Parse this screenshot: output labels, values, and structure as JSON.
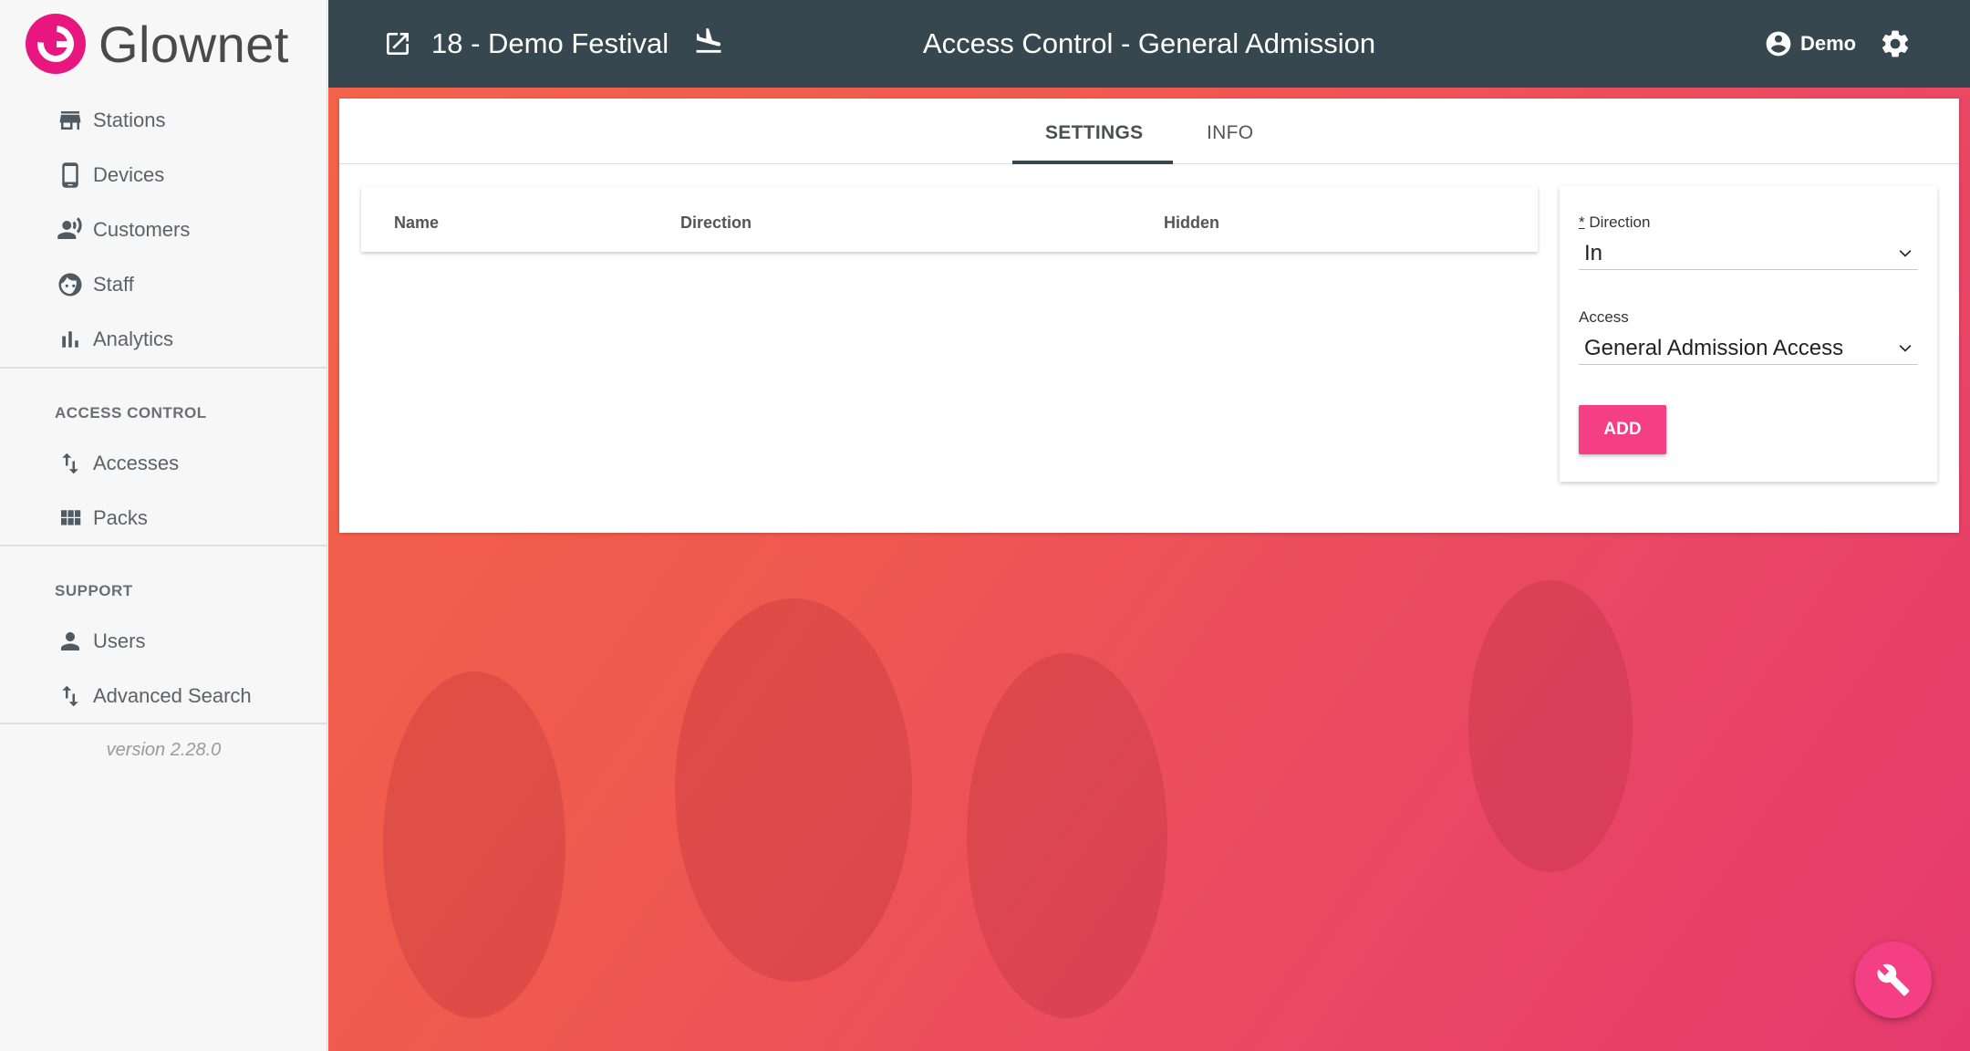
{
  "brand": {
    "name": "Glownet",
    "accent": "#e8177f"
  },
  "sidebar": {
    "items": [
      {
        "label": "Stations",
        "icon": "store-icon"
      },
      {
        "label": "Devices",
        "icon": "phone-icon"
      },
      {
        "label": "Customers",
        "icon": "customers-icon"
      },
      {
        "label": "Staff",
        "icon": "face-icon"
      },
      {
        "label": "Analytics",
        "icon": "bar-chart-icon"
      }
    ],
    "access_control": {
      "title": "ACCESS CONTROL",
      "items": [
        {
          "label": "Accesses",
          "icon": "swap-vert-icon"
        },
        {
          "label": "Packs",
          "icon": "grid-icon"
        }
      ]
    },
    "support": {
      "title": "SUPPORT",
      "items": [
        {
          "label": "Users",
          "icon": "person-icon"
        },
        {
          "label": "Advanced Search",
          "icon": "swap-vert-icon"
        }
      ]
    },
    "version": "version 2.28.0"
  },
  "header": {
    "event": "18 - Demo Festival",
    "title": "Access Control - General Admission",
    "user": "Demo",
    "background": "#37474f"
  },
  "tabs": [
    {
      "label": "SETTINGS",
      "active": true
    },
    {
      "label": "INFO",
      "active": false
    }
  ],
  "table": {
    "columns": [
      "Name",
      "Direction",
      "Hidden"
    ],
    "rows": []
  },
  "form": {
    "direction_label": "Direction",
    "required_mark": "*",
    "direction_value": "In",
    "access_label": "Access",
    "access_value": "General Admission Access",
    "add_label": "ADD",
    "button_color": "#f43f85"
  }
}
